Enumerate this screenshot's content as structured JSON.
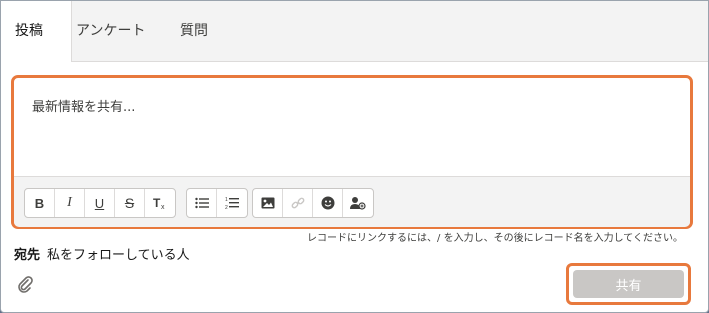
{
  "tabs": [
    {
      "label": "投稿"
    },
    {
      "label": "アンケート"
    },
    {
      "label": "質問"
    }
  ],
  "composer": {
    "placeholder": "最新情報を共有...",
    "toolbar": [
      {
        "icon": "bold-icon",
        "glyph": "B"
      },
      {
        "icon": "italic-icon",
        "glyph": "I"
      },
      {
        "icon": "underline-icon",
        "glyph": "U"
      },
      {
        "icon": "strikethrough-icon",
        "glyph": "S"
      },
      {
        "icon": "clear-formatting-icon",
        "glyph": "Tx"
      },
      {
        "icon": "bulleted-list-icon"
      },
      {
        "icon": "numbered-list-icon"
      },
      {
        "icon": "image-icon"
      },
      {
        "icon": "link-icon"
      },
      {
        "icon": "emoji-icon"
      },
      {
        "icon": "mention-icon"
      }
    ]
  },
  "hint": "レコードにリンクするには、/ を入力し、その後にレコード名を入力してください。",
  "recipient": {
    "label": "宛先",
    "value": "私をフォローしている人"
  },
  "share_button": {
    "label": "共有"
  },
  "colors": {
    "highlight": "#e8793d",
    "share_disabled": "#c9c7c5",
    "tab_bar": "#f3f3f3"
  }
}
